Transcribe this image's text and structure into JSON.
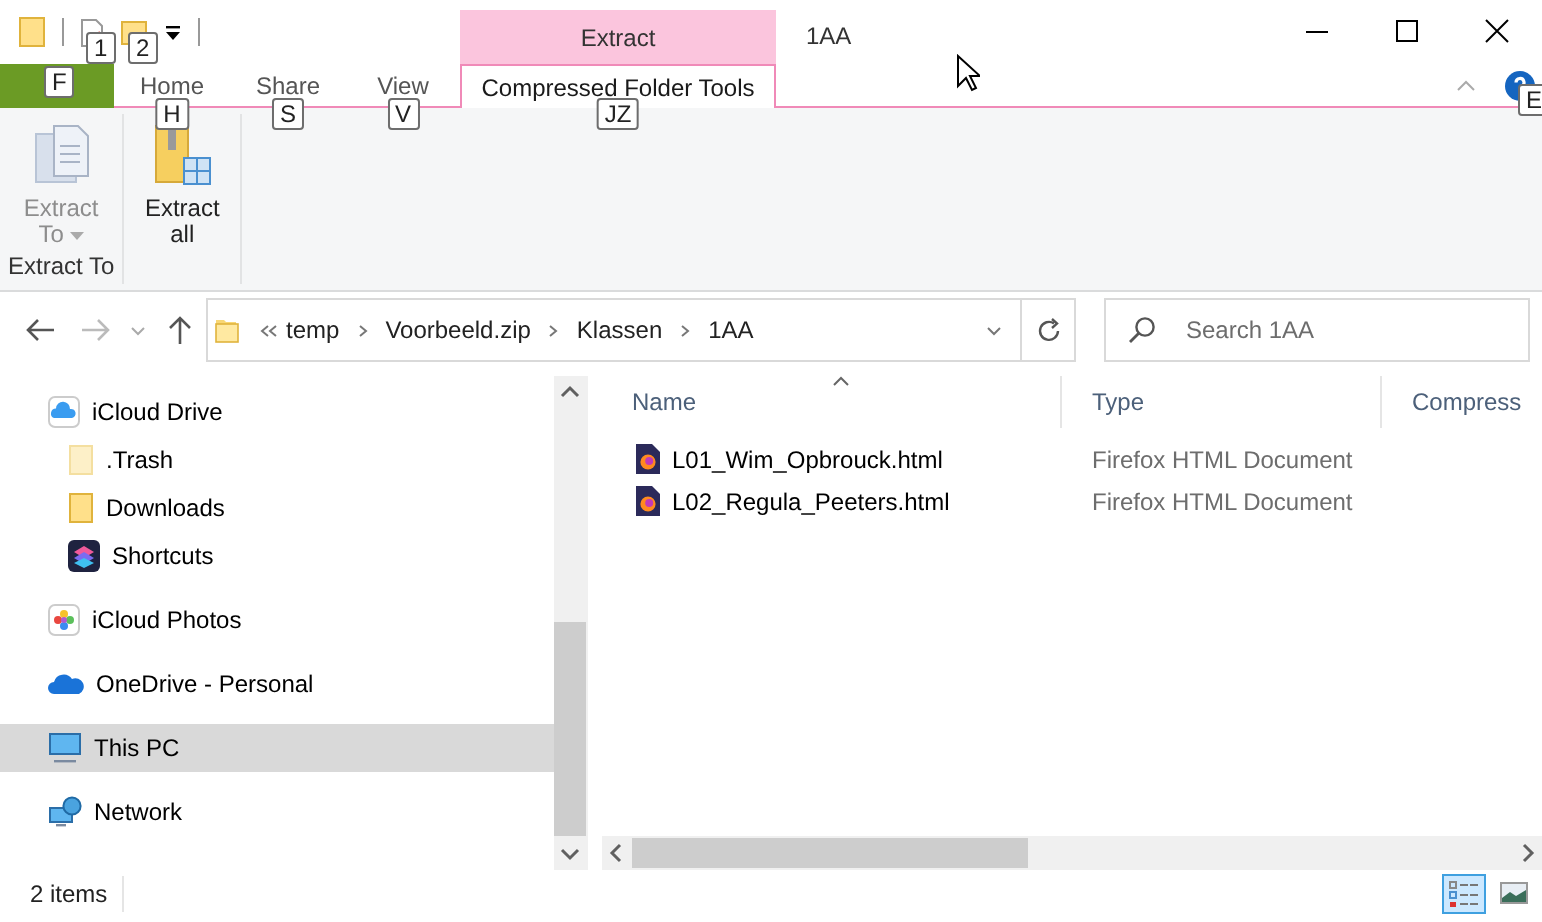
{
  "quick_access_toolbar": {
    "keytips": [
      "1",
      "2"
    ]
  },
  "contextual_tab_group": {
    "label": "Extract"
  },
  "window": {
    "title": "1AA"
  },
  "file_tab": {
    "keytip": "F"
  },
  "ribbon_tabs": [
    {
      "label": "Home",
      "keytip": "H",
      "selected": false
    },
    {
      "label": "Share",
      "keytip": "S",
      "selected": false
    },
    {
      "label": "View",
      "keytip": "V",
      "selected": false
    },
    {
      "label": "Compressed Folder Tools",
      "keytip": "JZ",
      "selected": true
    }
  ],
  "help_keytip": "E",
  "ribbon_groups": [
    {
      "label": "Extract To",
      "commands": [
        {
          "label": "Extract To",
          "kind": "extract-to",
          "disabled": true,
          "dropdown": true
        }
      ]
    },
    {
      "commands": [
        {
          "label": "Extract all",
          "kind": "extract-all",
          "disabled": false,
          "dropdown": false
        }
      ]
    }
  ],
  "address_bar": {
    "segments": [
      "temp",
      "Voorbeeld.zip",
      "Klassen",
      "1AA"
    ]
  },
  "search": {
    "placeholder": "Search 1AA"
  },
  "navigation_pane": [
    {
      "label": "iCloud Drive",
      "kind": "cloud",
      "selected": false,
      "children": [
        {
          "label": ".Trash",
          "kind": "hidden-folder",
          "selected": false
        },
        {
          "label": "Downloads",
          "kind": "folder",
          "selected": false
        },
        {
          "label": "Shortcuts",
          "kind": "shortcuts",
          "selected": false
        }
      ]
    },
    {
      "label": "iCloud Photos",
      "kind": "photos",
      "selected": false
    },
    {
      "label": "OneDrive - Personal",
      "kind": "onedrive",
      "selected": false
    },
    {
      "label": "This PC",
      "kind": "pc",
      "selected": true
    },
    {
      "label": "Network",
      "kind": "network",
      "selected": false
    }
  ],
  "file_list": {
    "columns": [
      {
        "label": "Name",
        "sorted": true
      },
      {
        "label": "Type",
        "sorted": false
      },
      {
        "label": "Compress",
        "sorted": false
      }
    ],
    "rows": [
      {
        "name": "L01_Wim_Opbrouck.html",
        "type": "Firefox HTML Document"
      },
      {
        "name": "L02_Regula_Peeters.html",
        "type": "Firefox HTML Document"
      }
    ]
  },
  "status_bar": {
    "item_count": "2 items",
    "views": [
      {
        "kind": "details",
        "selected": true
      },
      {
        "kind": "large-icons",
        "selected": false
      }
    ]
  }
}
